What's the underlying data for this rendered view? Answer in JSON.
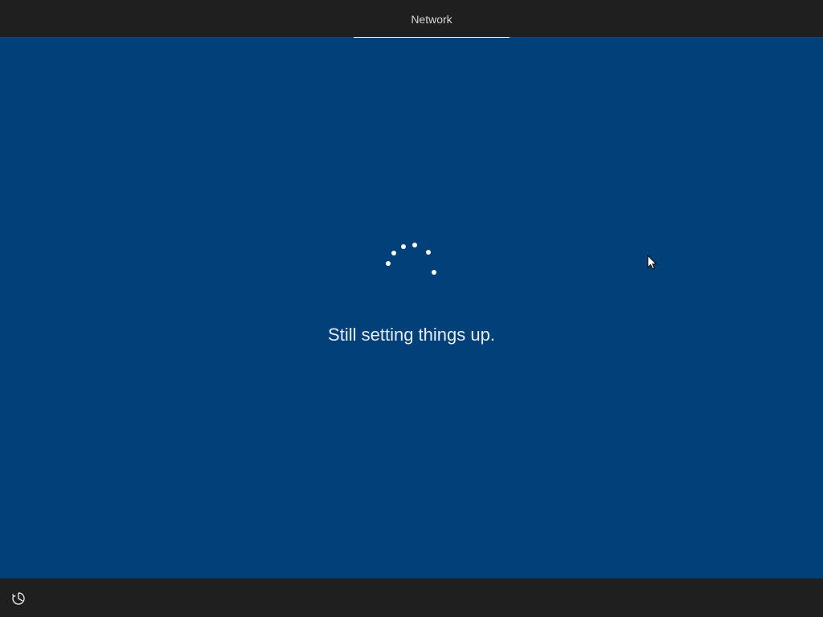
{
  "header": {
    "tab_label": "Network"
  },
  "main": {
    "status_text": "Still setting things up.",
    "background_color": "#024079"
  },
  "spinner": {
    "icon": "loading-dots-icon",
    "dot_count": 6
  },
  "footer": {
    "ease_of_access_icon": "ease-of-access-icon"
  },
  "cursor": {
    "icon": "mouse-pointer-icon"
  }
}
